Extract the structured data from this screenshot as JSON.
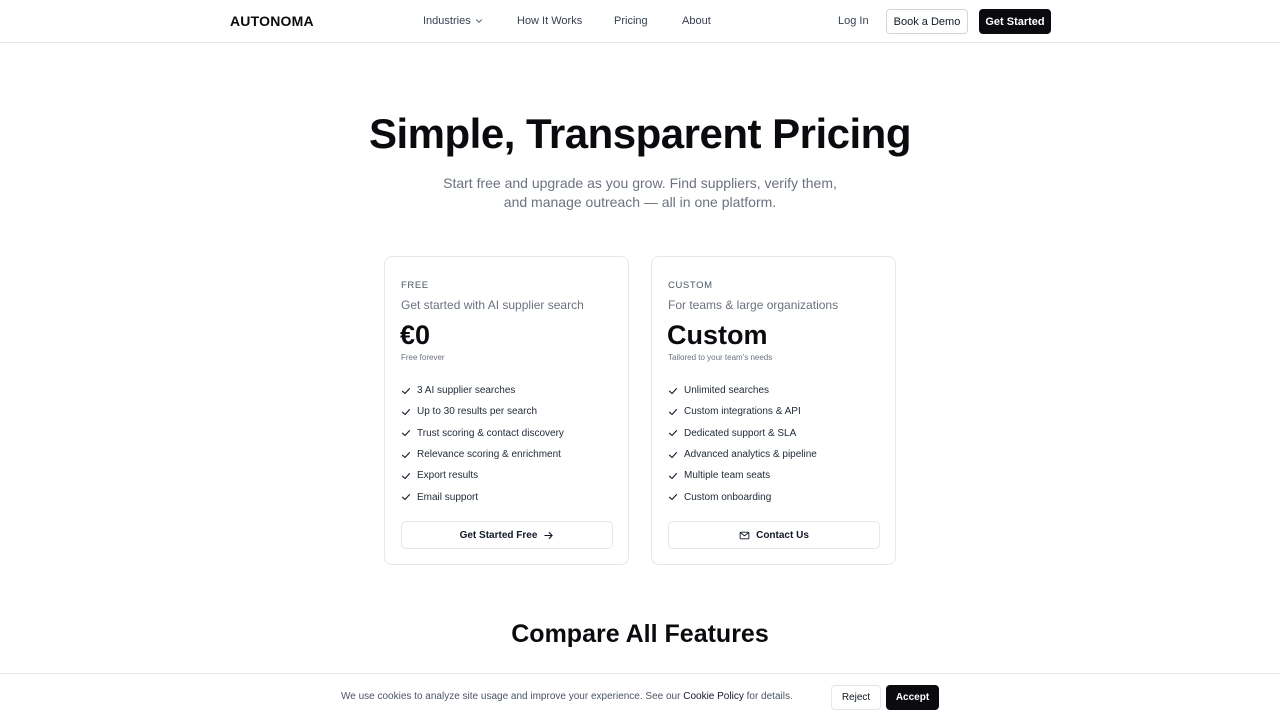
{
  "nav": {
    "logo": "AUTONOMA",
    "links": [
      "Industries",
      "How It Works",
      "Pricing",
      "About"
    ],
    "login": "Log In",
    "demo": "Book a Demo",
    "start": "Get Started"
  },
  "hero": {
    "title": "Simple, Transparent Pricing",
    "subtitle": "Start free and upgrade as you grow. Find suppliers, verify them, and manage outreach — all in one platform."
  },
  "plans": [
    {
      "tier": "FREE",
      "tagline": "Get started with AI supplier search",
      "price": "€0",
      "note": "Free forever",
      "features": [
        "3 AI supplier searches",
        "Up to 30 results per search",
        "Trust scoring & contact discovery",
        "Relevance scoring & enrichment",
        "Export results",
        "Email support"
      ],
      "cta": "Get Started Free"
    },
    {
      "tier": "CUSTOM",
      "tagline": "For teams & large organizations",
      "price": "Custom",
      "note": "Tailored to your team's needs",
      "features": [
        "Unlimited searches",
        "Custom integrations & API",
        "Dedicated support & SLA",
        "Advanced analytics & pipeline",
        "Multiple team seats",
        "Custom onboarding"
      ],
      "cta": "Contact Us"
    }
  ],
  "compare": {
    "title": "Compare All Features"
  },
  "cookie": {
    "text_before": "We use cookies to analyze site usage and improve your experience. See our ",
    "link": "Cookie Policy",
    "text_after": " for details.",
    "reject": "Reject",
    "accept": "Accept"
  },
  "icons": {
    "chevron": "chevron-down-icon",
    "check": "check-icon",
    "arrow": "arrow-right-icon",
    "mail": "mail-icon"
  }
}
